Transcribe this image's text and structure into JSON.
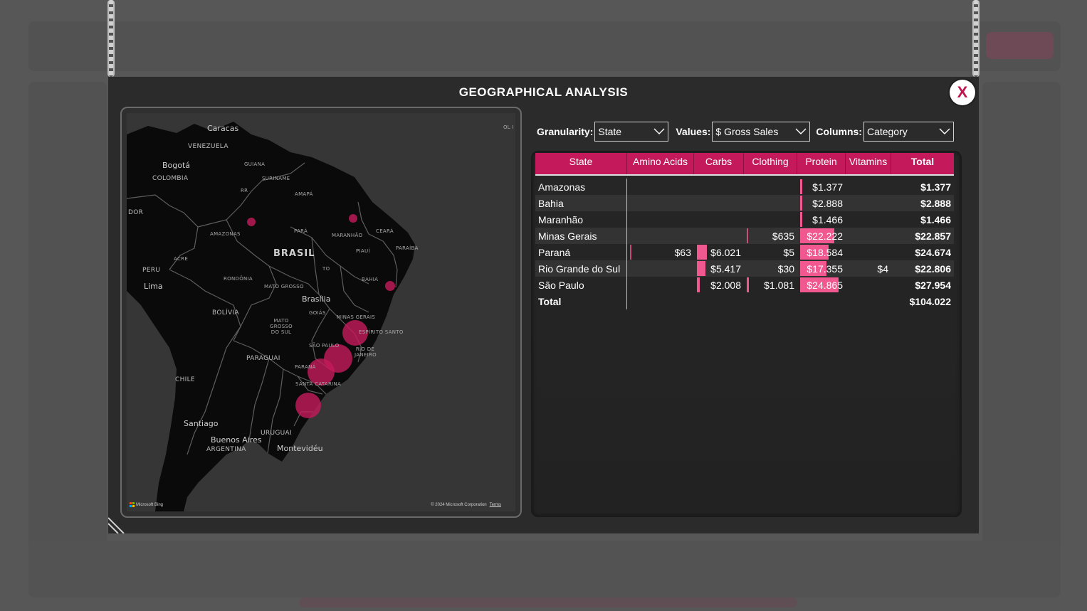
{
  "modal": {
    "title": "GEOGRAPHICAL ANALYSIS",
    "close_label": "X"
  },
  "map": {
    "labels": {
      "caracas": "Caracas",
      "venezuela": "VENEZUELA",
      "bogota": "Bogotá",
      "colombia": "COLOMBIA",
      "guiana": "GUIANA",
      "suriname": "SURINAME",
      "rr": "RR",
      "amapa": "AMAPÁ",
      "equador": "DOR",
      "amazonas": "AMAZONAS",
      "para": "PARÁ",
      "maranhao": "MARANHÃO",
      "ceara": "CEARÁ",
      "brasil": "BRASIL",
      "piaui": "PIAUÍ",
      "paraiba": "PARAÍBA",
      "peru": "PERU",
      "acre": "ACRE",
      "lima": "Lima",
      "rondonia": "RONDÔNIA",
      "mato_grosso": "MATO GROSSO",
      "to": "TO",
      "bahia": "BAHIA",
      "brasilia": "Brasília",
      "goias": "GOIÁS",
      "bolivia": "BOLÍVIA",
      "minas_gerais": "MINAS GERAIS",
      "mato_grosso_sul": "MATO GROSSO DO SUL",
      "espirito_santo": "ESPÍRITO SANTO",
      "sao_paulo": "SÃO PAULO",
      "rio_janeiro": "RIO DE JANEIRO",
      "paraguai": "PARAGUAI",
      "parana": "PARANÁ",
      "santa_catarina": "SANTA CATARINA",
      "chile": "CHILE",
      "santiago": "Santiago",
      "uruguai": "URUGUAI",
      "buenos_aires": "Buenos Aires",
      "argentina": "ARGENTINA",
      "montevideu": "Montevidéu",
      "ol": "OL I"
    },
    "attribution_left": "Microsoft Bing",
    "attribution_right": "© 2024 Microsoft Corporation",
    "terms": "Terms",
    "bubble_color": "#c41a5b"
  },
  "filters": {
    "granularity_label": "Granularity:",
    "granularity_value": "State",
    "values_label": "Values:",
    "values_value": "$ Gross Sales",
    "columns_label": "Columns:",
    "columns_value": "Category"
  },
  "table": {
    "accent": "#c41a5b",
    "bar_color": "#f0588f",
    "headers": [
      "State",
      "Amino Acids",
      "Carbs",
      "Clothing",
      "Protein",
      "Vitamins",
      "Total"
    ],
    "rows": [
      {
        "state": "Amazonas",
        "amino": "",
        "carbs": "",
        "clothing": "",
        "protein": "$1.377",
        "vitamins": "",
        "total": "$1.377"
      },
      {
        "state": "Bahia",
        "amino": "",
        "carbs": "",
        "clothing": "",
        "protein": "$2.888",
        "vitamins": "",
        "total": "$2.888"
      },
      {
        "state": "Maranhão",
        "amino": "",
        "carbs": "",
        "clothing": "",
        "protein": "$1.466",
        "vitamins": "",
        "total": "$1.466"
      },
      {
        "state": "Minas Gerais",
        "amino": "",
        "carbs": "",
        "clothing": "$635",
        "protein": "$22.222",
        "vitamins": "",
        "total": "$22.857"
      },
      {
        "state": "Paraná",
        "amino": "$63",
        "carbs": "$6.021",
        "clothing": "$5",
        "protein": "$18.584",
        "vitamins": "",
        "total": "$24.674"
      },
      {
        "state": "Rio Grande do Sul",
        "amino": "",
        "carbs": "$5.417",
        "clothing": "$30",
        "protein": "$17.355",
        "vitamins": "$4",
        "total": "$22.806"
      },
      {
        "state": "São Paulo",
        "amino": "",
        "carbs": "$2.008",
        "clothing": "$1.081",
        "protein": "$24.865",
        "vitamins": "",
        "total": "$27.954"
      },
      {
        "state": "Total",
        "amino": "",
        "carbs": "",
        "clothing": "",
        "protein": "",
        "vitamins": "",
        "total": "$104.022"
      }
    ],
    "bar_fractions": {
      "amino": [
        0,
        0,
        0,
        0,
        0.01,
        0,
        0,
        0
      ],
      "carbs": [
        0,
        0,
        0,
        0,
        0.22,
        0.2,
        0.07,
        0
      ],
      "clothing": [
        0,
        0,
        0,
        0.02,
        0,
        0,
        0.04,
        0
      ],
      "protein": [
        0.05,
        0.05,
        0.05,
        0.8,
        0.67,
        0.62,
        0.9,
        0
      ]
    }
  }
}
